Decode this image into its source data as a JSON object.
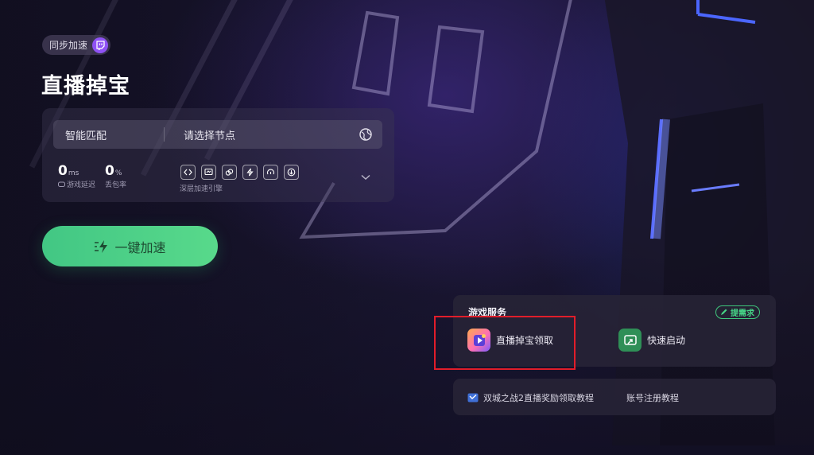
{
  "header": {
    "sync_label": "同步加速",
    "page_title": "直播掉宝"
  },
  "node_panel": {
    "smart_match": "智能匹配",
    "node_placeholder": "请选择节点",
    "latency_value": "0",
    "latency_unit": "ms",
    "latency_label": "游戏延迟",
    "loss_value": "0",
    "loss_unit": "%",
    "loss_label": "丢包率",
    "engine_label": "深层加速引擎",
    "engine_icons": [
      "code-icon",
      "screen-icon",
      "link-icon",
      "bolt-icon",
      "gamepad-icon",
      "download-icon"
    ]
  },
  "accelerate_button": {
    "label": "一键加速"
  },
  "game_services": {
    "title": "游戏服务",
    "request_label": "提需求",
    "items": [
      {
        "label": "直播掉宝领取",
        "icon": "drops-app-icon"
      },
      {
        "label": "快速启动",
        "icon": "quick-launch-icon"
      }
    ]
  },
  "tutorials": [
    {
      "label": "双城之战2直播奖励领取教程"
    },
    {
      "label": "账号注册教程"
    }
  ],
  "colors": {
    "accent_green": "#4fd189",
    "twitch_purple": "#8f52f5",
    "highlight_red": "#e11d2a"
  }
}
